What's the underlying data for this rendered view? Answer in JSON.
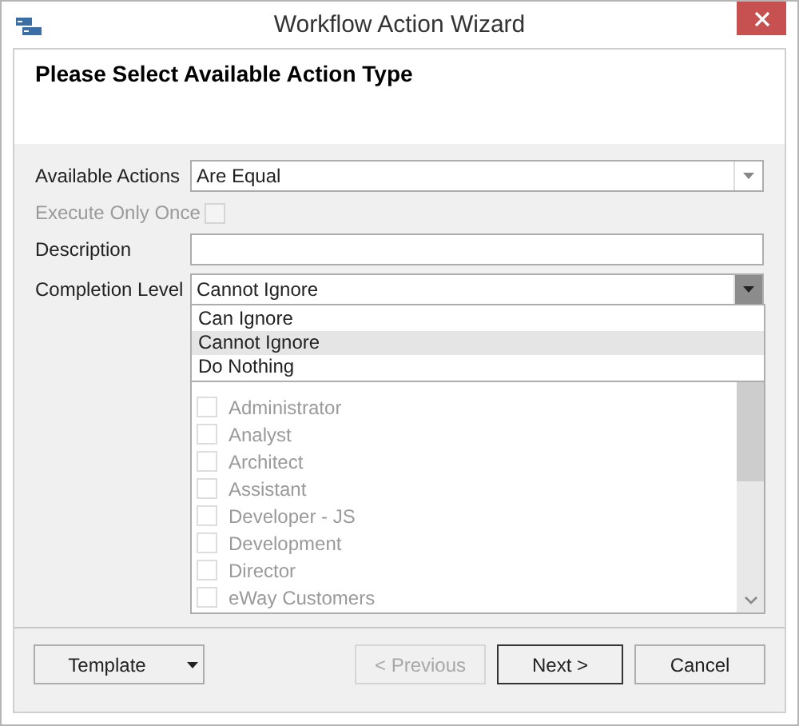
{
  "window": {
    "title": "Workflow Action Wizard"
  },
  "header": {
    "title": "Please Select Available Action Type"
  },
  "fields": [
    {
      "kind": "combo",
      "label": "Available Actions",
      "value": "Are Equal",
      "open": false
    },
    {
      "kind": "checkbox",
      "label": "Execute Only Once",
      "checked": false,
      "disabled": true
    },
    {
      "kind": "text",
      "label": "Description"
    },
    {
      "kind": "combo",
      "label": "Completion Level",
      "value": "Cannot Ignore",
      "open": true,
      "options": [
        {
          "label": "Can Ignore",
          "selected": false
        },
        {
          "label": "Cannot Ignore",
          "selected": true
        },
        {
          "label": "Do Nothing",
          "selected": false
        }
      ]
    }
  ],
  "role_list": {
    "disabled": true,
    "items": [
      {
        "label": "Administrator",
        "checked": false
      },
      {
        "label": "Analyst",
        "checked": false
      },
      {
        "label": "Architect",
        "checked": false
      },
      {
        "label": "Assistant",
        "checked": false
      },
      {
        "label": "Developer - JS",
        "checked": false
      },
      {
        "label": "Development",
        "checked": false
      },
      {
        "label": "Director",
        "checked": false
      },
      {
        "label": "eWay Customers",
        "checked": false
      }
    ]
  },
  "buttons": [
    {
      "kind": "split",
      "label": "Template",
      "disabled": false,
      "default": false
    },
    {
      "kind": "plain",
      "label": "< Previous",
      "disabled": true,
      "default": false
    },
    {
      "kind": "plain",
      "label": "Next >",
      "disabled": false,
      "default": true
    },
    {
      "kind": "plain",
      "label": "Cancel",
      "disabled": false,
      "default": false
    }
  ]
}
